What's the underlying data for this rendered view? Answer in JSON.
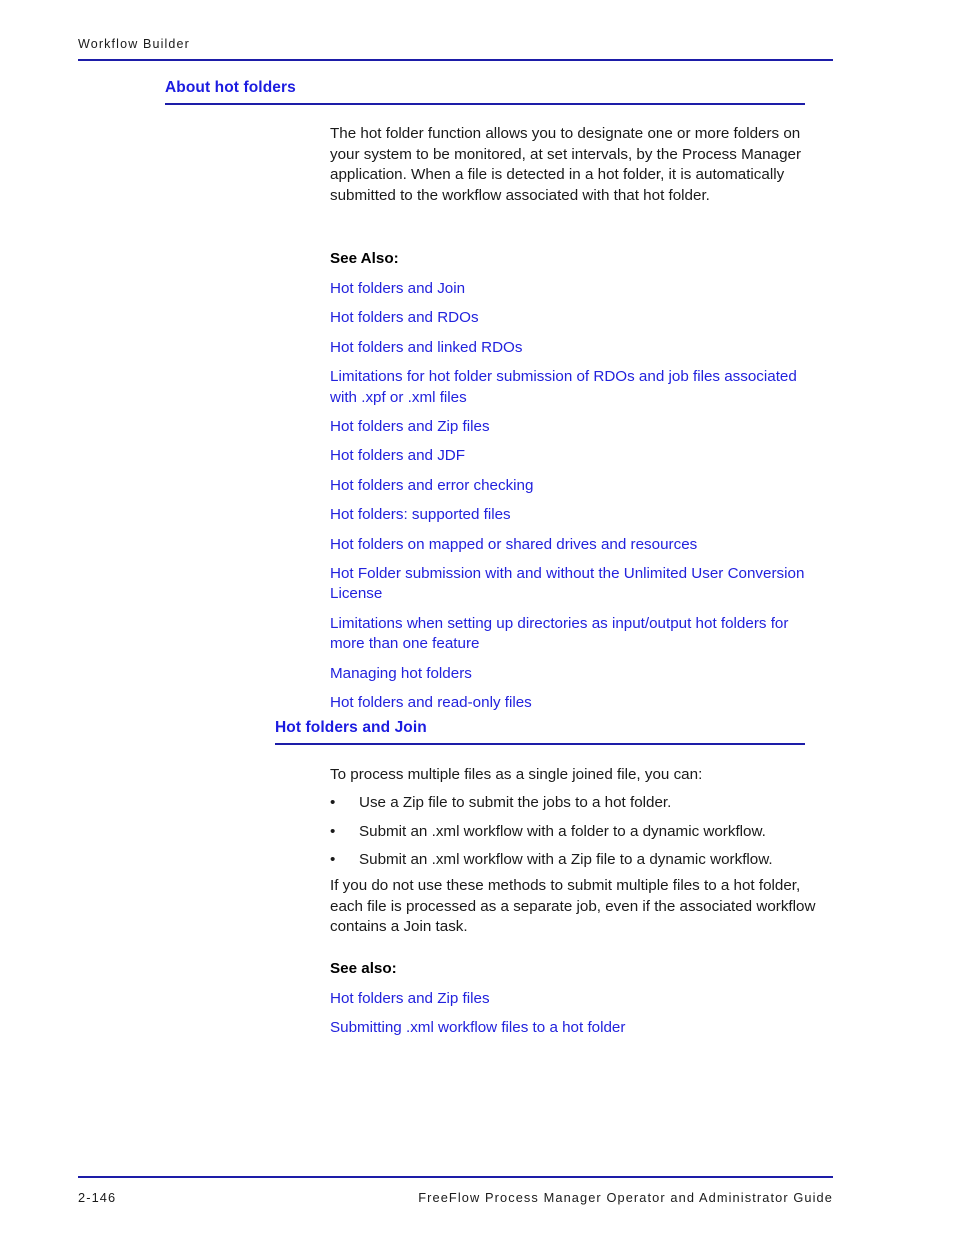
{
  "header": {
    "running_title": "Workflow Builder"
  },
  "colors": {
    "heading_blue": "#1c1ce0",
    "link_blue": "#2222dd",
    "rule_blue": "#1d1da8",
    "body_black": "#1a1a1a"
  },
  "sections": [
    {
      "heading": "About hot folders",
      "level": 1,
      "intro": "The hot folder function allows you to designate one or more folders on your system to be monitored, at set intervals, by the Process Manager application. When a file is detected in a hot folder, it is automatically submitted to the workflow associated with that hot folder.",
      "see_also_label": "See Also:",
      "links": [
        "Hot folders and Join",
        "Hot folders and RDOs",
        "Hot folders and linked RDOs",
        "Limitations for hot folder submission of RDOs and job files associated with .xpf or .xml files",
        "Hot folders and Zip files",
        "Hot folders and JDF",
        "Hot folders and error checking",
        "Hot folders: supported files",
        "Hot folders on mapped or shared drives and resources",
        "Hot Folder submission with and without the Unlimited User Conversion License",
        "Limitations when setting up directories as input/output hot folders for more than one feature",
        "Managing hot folders",
        "Hot folders and read-only files"
      ]
    },
    {
      "heading": "Hot folders and Join",
      "level": 2,
      "intro": "To process multiple files as a single joined file, you can:",
      "bullet_marker": "•",
      "bullets": [
        "Use a Zip file to submit the jobs to a hot folder.",
        "Submit an .xml workflow with a folder to a dynamic workflow.",
        "Submit an .xml workflow with a Zip file to a dynamic workflow."
      ],
      "closing": "If you do not use these methods to submit multiple files to a hot folder, each file is processed as a separate job, even if the associated workflow contains a Join task.",
      "see_also_label": "See also:",
      "links": [
        "Hot folders and Zip files",
        "Submitting .xml workflow files to a hot folder"
      ]
    }
  ],
  "footer": {
    "page_number": "2-146",
    "guide_title": "FreeFlow Process Manager Operator and Administrator Guide"
  }
}
